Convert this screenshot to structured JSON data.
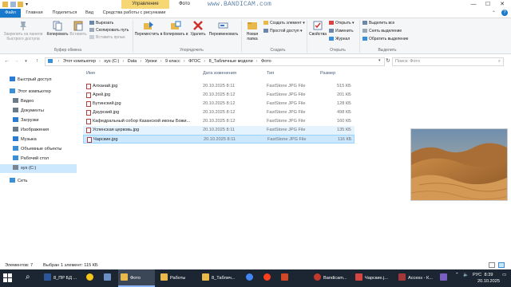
{
  "window": {
    "context_tab": "Управление",
    "title": "Фото",
    "watermark": "www.BANDICAM.com"
  },
  "ribbon_tabs": [
    "Файл",
    "Главная",
    "Поделиться",
    "Вид",
    "Средства работы с рисунками"
  ],
  "ribbon": {
    "clipboard": {
      "pin_label": "Закрепить на панели быстрого доступа",
      "copy_label": "Копировать",
      "paste_label": "Вставить",
      "cut_label": "Вырезать",
      "copy_path_label": "Скопировать путь",
      "paste_shortcut_label": "Вставить ярлык",
      "group_label": "Буфер обмена"
    },
    "organize": {
      "move_label": "Переместить в",
      "copy_to_label": "Копировать в",
      "delete_label": "Удалить",
      "rename_label": "Переименовать",
      "group_label": "Упорядочить"
    },
    "new": {
      "new_folder_label": "Новая папка",
      "new_item_label": "Создать элемент",
      "easy_access_label": "Простой доступ",
      "group_label": "Создать"
    },
    "open": {
      "properties_label": "Свойства",
      "open_label": "Открыть",
      "edit_label": "Изменить",
      "history_label": "Журнал",
      "group_label": "Открыть"
    },
    "select": {
      "select_all_label": "Выделить все",
      "select_none_label": "Снять выделение",
      "invert_label": "Обратить выделение",
      "group_label": "Выделить"
    }
  },
  "address": {
    "crumbs": [
      "Этот компьютер",
      "sys (C:)",
      "Data",
      "Уроки",
      "9 класс",
      "ФГОС",
      "8_Табличные модели",
      "Фото"
    ],
    "search_placeholder": "Поиск: Фото"
  },
  "nav": [
    {
      "label": "Быстрый доступ",
      "icon": "star-icon",
      "color": "#2a7bd6"
    },
    {
      "label": "Этот компьютер",
      "icon": "computer-icon",
      "color": "#3b8fd6"
    },
    {
      "label": "Видео",
      "icon": "video-icon",
      "color": "#6b7b8c"
    },
    {
      "label": "Документы",
      "icon": "documents-icon",
      "color": "#6b7b8c"
    },
    {
      "label": "Загрузки",
      "icon": "downloads-icon",
      "color": "#2a7bd6"
    },
    {
      "label": "Изображения",
      "icon": "pictures-icon",
      "color": "#6b7b8c"
    },
    {
      "label": "Музыка",
      "icon": "music-icon",
      "color": "#2a7bd6"
    },
    {
      "label": "Объемные объекты",
      "icon": "3d-objects-icon",
      "color": "#3b8fd6"
    },
    {
      "label": "Рабочий стол",
      "icon": "desktop-icon",
      "color": "#3b8fd6"
    },
    {
      "label": "sys (C:)",
      "icon": "drive-icon",
      "color": "#7a8590"
    },
    {
      "label": "Сеть",
      "icon": "network-icon",
      "color": "#3b8fd6"
    }
  ],
  "columns": {
    "name": "Имя",
    "date": "Дата изменения",
    "type": "Тип",
    "size": "Размер"
  },
  "files": [
    {
      "name": "Алханай.jpg",
      "date": "20.10.2025 8:11",
      "type": "FastStone JPG File",
      "size": "515 КБ"
    },
    {
      "name": "Арей.jpg",
      "date": "20.10.2025 8:12",
      "type": "FastStone JPG File",
      "size": "201 КБ"
    },
    {
      "name": "Бутинский.jpg",
      "date": "20.10.2025 8:12",
      "type": "FastStone JPG File",
      "size": "128 КБ"
    },
    {
      "name": "Даурский.jpg",
      "date": "20.10.2025 8:12",
      "type": "FastStone JPG File",
      "size": "498 КБ"
    },
    {
      "name": "Кафедральный собор Казанской иконы Божи...",
      "date": "20.10.2025 8:12",
      "type": "FastStone JPG File",
      "size": "160 КБ"
    },
    {
      "name": "Успенская церковь.jpg",
      "date": "20.10.2025 8:11",
      "type": "FastStone JPG File",
      "size": "135 КБ"
    },
    {
      "name": "Чарские.jpg",
      "date": "20.10.2025 8:11",
      "type": "FastStone JPG File",
      "size": "116 КБ"
    }
  ],
  "status": {
    "count": "Элементов: 7",
    "selected": "Выбран 1 элемент: 115 КБ"
  },
  "taskbar": {
    "apps": [
      {
        "label": "8_ПР БД ...",
        "icon": "word-icon",
        "color": "#2b579a"
      },
      {
        "label": "",
        "icon": "yandex-browser-icon",
        "color": "#f5c518"
      },
      {
        "label": "",
        "icon": "app-icon",
        "color": "#6b8fc4"
      },
      {
        "label": "Фото",
        "icon": "folder-icon",
        "color": "#e8b84a"
      },
      {
        "label": "Работы",
        "icon": "folder-icon",
        "color": "#e8b84a"
      },
      {
        "label": "8_Таблич...",
        "icon": "folder-icon",
        "color": "#e8b84a"
      },
      {
        "label": "",
        "icon": "chrome-icon",
        "color": "#4285f4"
      },
      {
        "label": "",
        "icon": "yandex-icon",
        "color": "#fc3f1d"
      },
      {
        "label": "",
        "icon": "powerpoint-icon",
        "color": "#d24726"
      },
      {
        "label": "Bandicam...",
        "icon": "bandicam-icon",
        "color": "#c0392b"
      },
      {
        "label": "Чарские.j...",
        "icon": "faststone-icon",
        "color": "#d64541"
      },
      {
        "label": "Access - К...",
        "icon": "access-icon",
        "color": "#a4373a"
      },
      {
        "label": "",
        "icon": "app-icon",
        "color": "#7a5fc2"
      }
    ],
    "lang": "РУС",
    "time": "8:39",
    "date": "20.10.2025"
  }
}
